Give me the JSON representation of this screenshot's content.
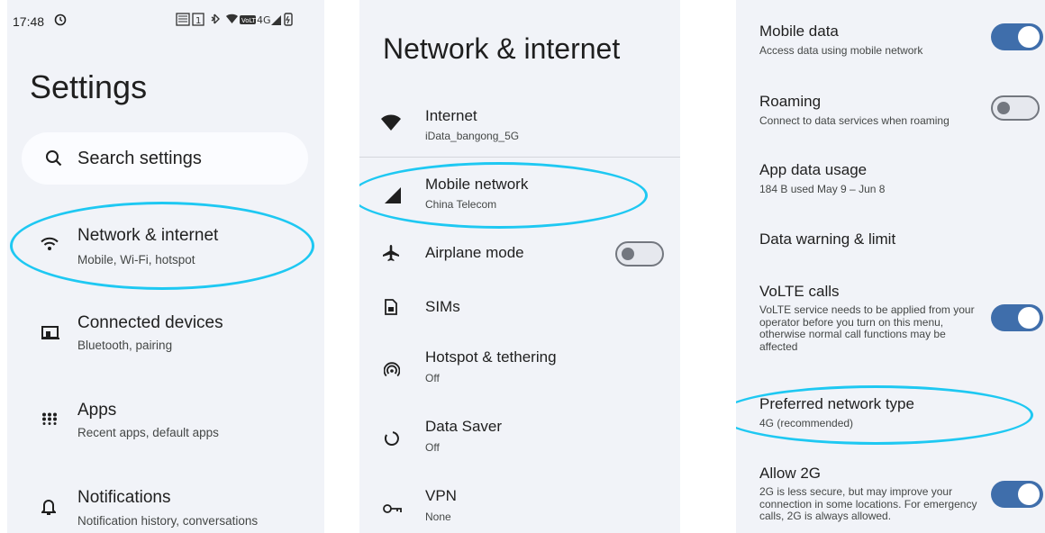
{
  "panel1": {
    "status_time": "17:48",
    "page_title": "Settings",
    "search_placeholder": "Search settings",
    "items": [
      {
        "title": "Network & internet",
        "subtitle": "Mobile, Wi-Fi, hotspot",
        "icon": "wifi-icon"
      },
      {
        "title": "Connected devices",
        "subtitle": "Bluetooth, pairing",
        "icon": "devices-icon"
      },
      {
        "title": "Apps",
        "subtitle": "Recent apps, default apps",
        "icon": "apps-grid-icon"
      },
      {
        "title": "Notifications",
        "subtitle": "Notification history, conversations",
        "icon": "bell-icon"
      }
    ]
  },
  "panel2": {
    "page_title": "Network & internet",
    "items": [
      {
        "title": "Internet",
        "subtitle": "iData_bangong_5G",
        "icon": "wifi-icon"
      },
      {
        "title": "Mobile network",
        "subtitle": "China Telecom",
        "icon": "cell-signal-icon"
      },
      {
        "title": "Airplane mode",
        "subtitle": "",
        "icon": "airplane-icon",
        "toggle": "off"
      },
      {
        "title": "SIMs",
        "subtitle": "",
        "icon": "sim-icon"
      },
      {
        "title": "Hotspot & tethering",
        "subtitle": "Off",
        "icon": "hotspot-icon"
      },
      {
        "title": "Data Saver",
        "subtitle": "Off",
        "icon": "data-saver-icon"
      },
      {
        "title": "VPN",
        "subtitle": "None",
        "icon": "vpn-key-icon"
      }
    ]
  },
  "panel3": {
    "items": [
      {
        "title": "Mobile data",
        "subtitle": "Access data using mobile network",
        "toggle": "on"
      },
      {
        "title": "Roaming",
        "subtitle": "Connect to data services when roaming",
        "toggle": "off"
      },
      {
        "title": "App data usage",
        "subtitle": "184 B used May 9 – Jun 8"
      },
      {
        "title": "Data warning & limit",
        "subtitle": ""
      },
      {
        "title": "VoLTE calls",
        "subtitle": "VoLTE service needs to be applied from your operator before you turn on this menu, otherwise normal call functions may be affected",
        "toggle": "on"
      },
      {
        "title": "Preferred network type",
        "subtitle": "4G (recommended)"
      },
      {
        "title": "Allow 2G",
        "subtitle": "2G is less secure, but may improve your connection in some locations. For emergency calls, 2G is always allowed.",
        "toggle": "on"
      }
    ]
  },
  "colors": {
    "background": "#f1f3f8",
    "highlight": "#1ec8f2",
    "toggle_on": "#3f6eab"
  }
}
